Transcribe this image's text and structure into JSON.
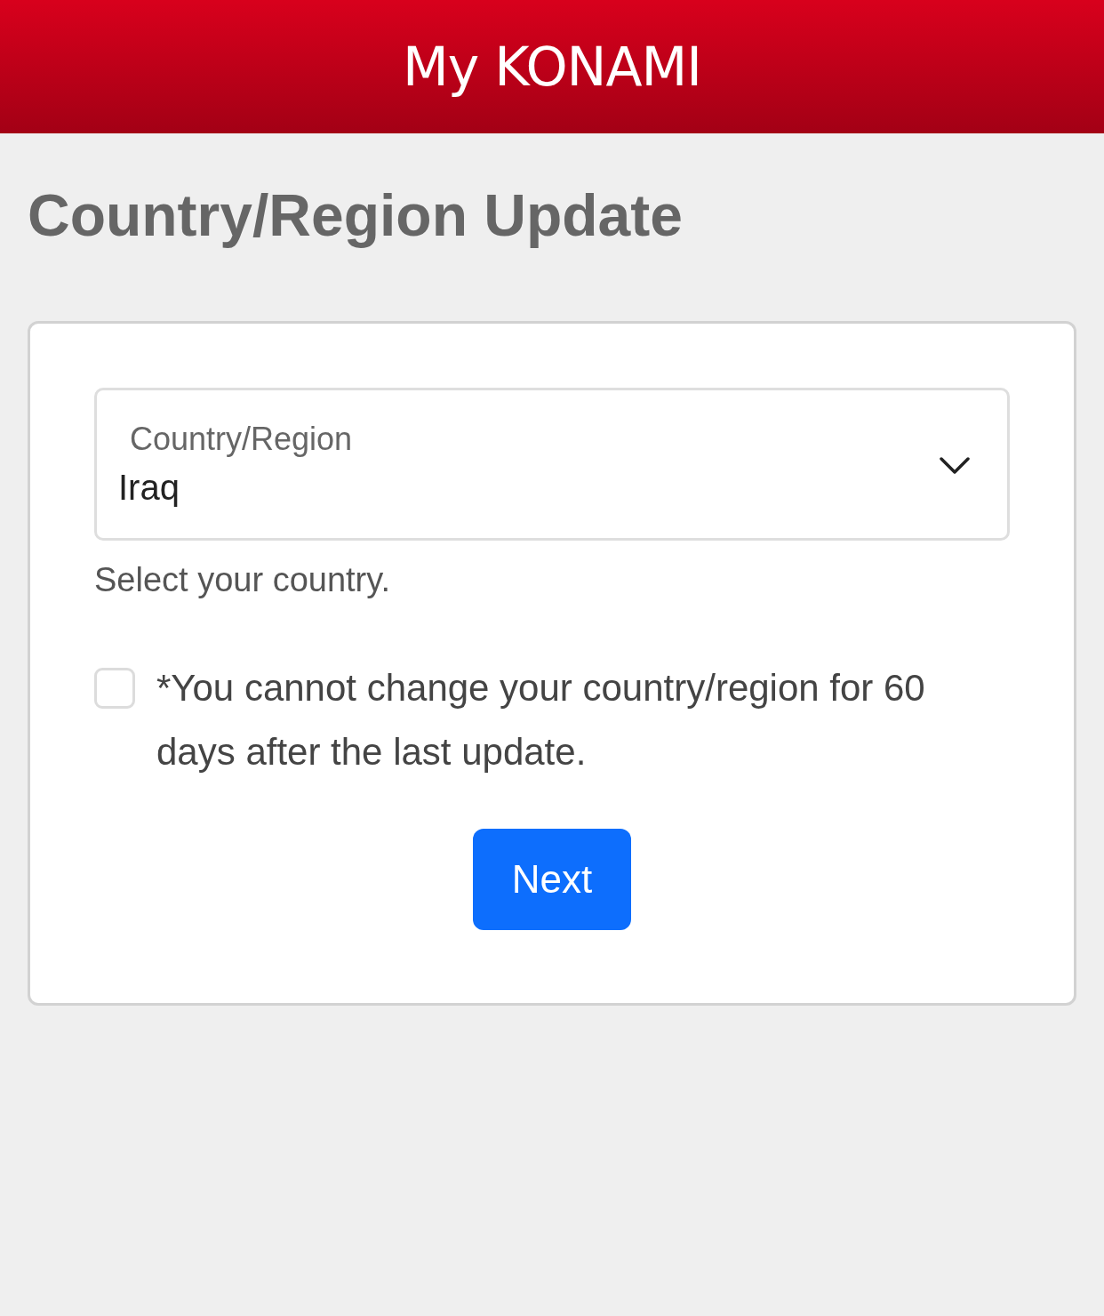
{
  "header": {
    "logo": "My KONAMI"
  },
  "title": "Country/Region Update",
  "form": {
    "select": {
      "label": "Country/Region",
      "value": "Iraq"
    },
    "help": "Select your country.",
    "checkbox": {
      "label": "*You cannot change your country/region for 60 days after the last update.",
      "checked": false
    },
    "button": "Next"
  }
}
